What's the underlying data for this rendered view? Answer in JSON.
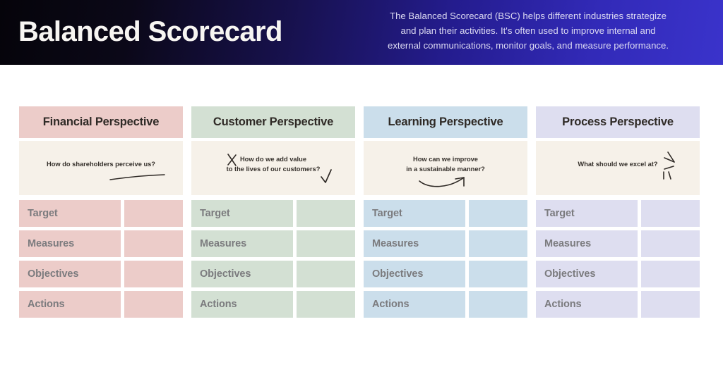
{
  "banner": {
    "title": "Balanced Scorecard",
    "description_lines": [
      "The Balanced Scorecard (BSC) helps different industries strategize",
      "and plan their activities. It's often used to improve internal and",
      "external communications, monitor goals, and measure performance."
    ],
    "gradient_start": "#05040a",
    "gradient_end": "#3a33cb",
    "title_color": "#f7f5f2",
    "description_color": "#dcdaf2"
  },
  "board": {
    "question_cell_color": "#f6f1e9",
    "row_labels": [
      "Target",
      "Measures",
      "Objectives",
      "Actions"
    ],
    "columns": [
      {
        "header": "Financial Perspective",
        "question_line1": "How do shareholders perceive us?",
        "question_line2": "",
        "doodle": "underline-stroke",
        "color": "#ecccc9"
      },
      {
        "header": "Customer Perspective",
        "question_line1": "How do we add value",
        "question_line2": "to the lives of our customers?",
        "doodle": "x-mark-and-check",
        "color": "#d3e0d3"
      },
      {
        "header": "Learning Perspective",
        "question_line1": "How can we improve",
        "question_line2": "in a sustainable manner?",
        "doodle": "curved-arrow",
        "color": "#cbdeeb"
      },
      {
        "header": "Process Perspective",
        "question_line1": "What should we excel at?",
        "question_line2": "",
        "doodle": "sparkle-burst",
        "color": "#dedef0"
      }
    ]
  }
}
